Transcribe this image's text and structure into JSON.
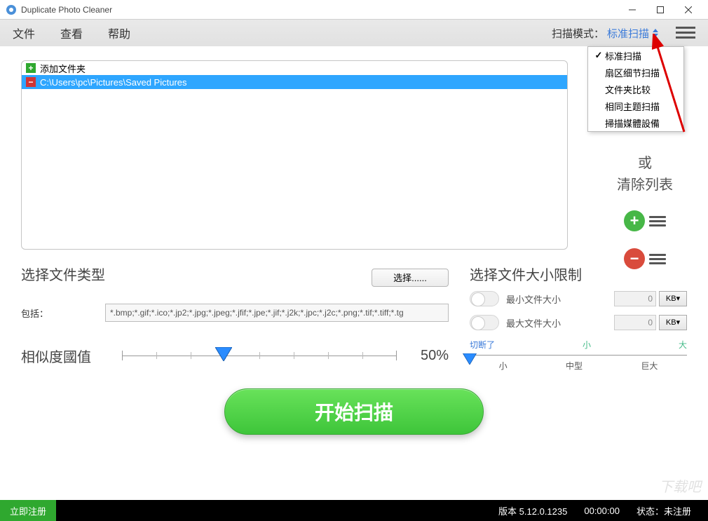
{
  "window": {
    "title": "Duplicate Photo Cleaner"
  },
  "menu": {
    "file": "文件",
    "view": "查看",
    "help": "帮助"
  },
  "scanmode": {
    "label": "扫描模式：",
    "selected": "标准扫描",
    "options": {
      "standard": "标准扫描",
      "detail": "扇区细节扫描",
      "folder_compare": "文件夹比较",
      "same_subject": "相同主题扫描",
      "media_device": "掃描媒體設備"
    }
  },
  "folders": {
    "add_label": "添加文件夹",
    "path": "C:\\Users\\pc\\Pictures\\Saved Pictures"
  },
  "side": {
    "or": "或",
    "clear_list": "清除列表"
  },
  "filetype": {
    "title": "选择文件类型",
    "select_btn": "选择......",
    "include_label": "包括：",
    "include_value": "*.bmp;*.gif;*.ico;*.jp2;*.jpg;*.jpeg;*.jfif;*.jpe;*.jif;*.j2k;*.jpc;*.j2c;*.png;*.tif;*.tiff;*.tg"
  },
  "similarity": {
    "label": "相似度國值",
    "value": "50%"
  },
  "sizelimit": {
    "title": "选择文件大小限制",
    "min_label": "最小文件大小",
    "max_label": "最大文件大小",
    "min_value": "0",
    "max_value": "0",
    "unit": "KB",
    "top_labels": {
      "cut": "切断了",
      "small_top": "小",
      "big_top": "大"
    },
    "bottom_labels": {
      "small": "小",
      "mid": "中型",
      "huge": "巨大"
    }
  },
  "start_button": "开始扫描",
  "footer": {
    "register": "立即注册",
    "version_label": "版本",
    "version": "5.12.0.1235",
    "time": "00:00:00",
    "status_label": "状态：",
    "status_value": "未注册"
  },
  "watermark": "下载吧"
}
